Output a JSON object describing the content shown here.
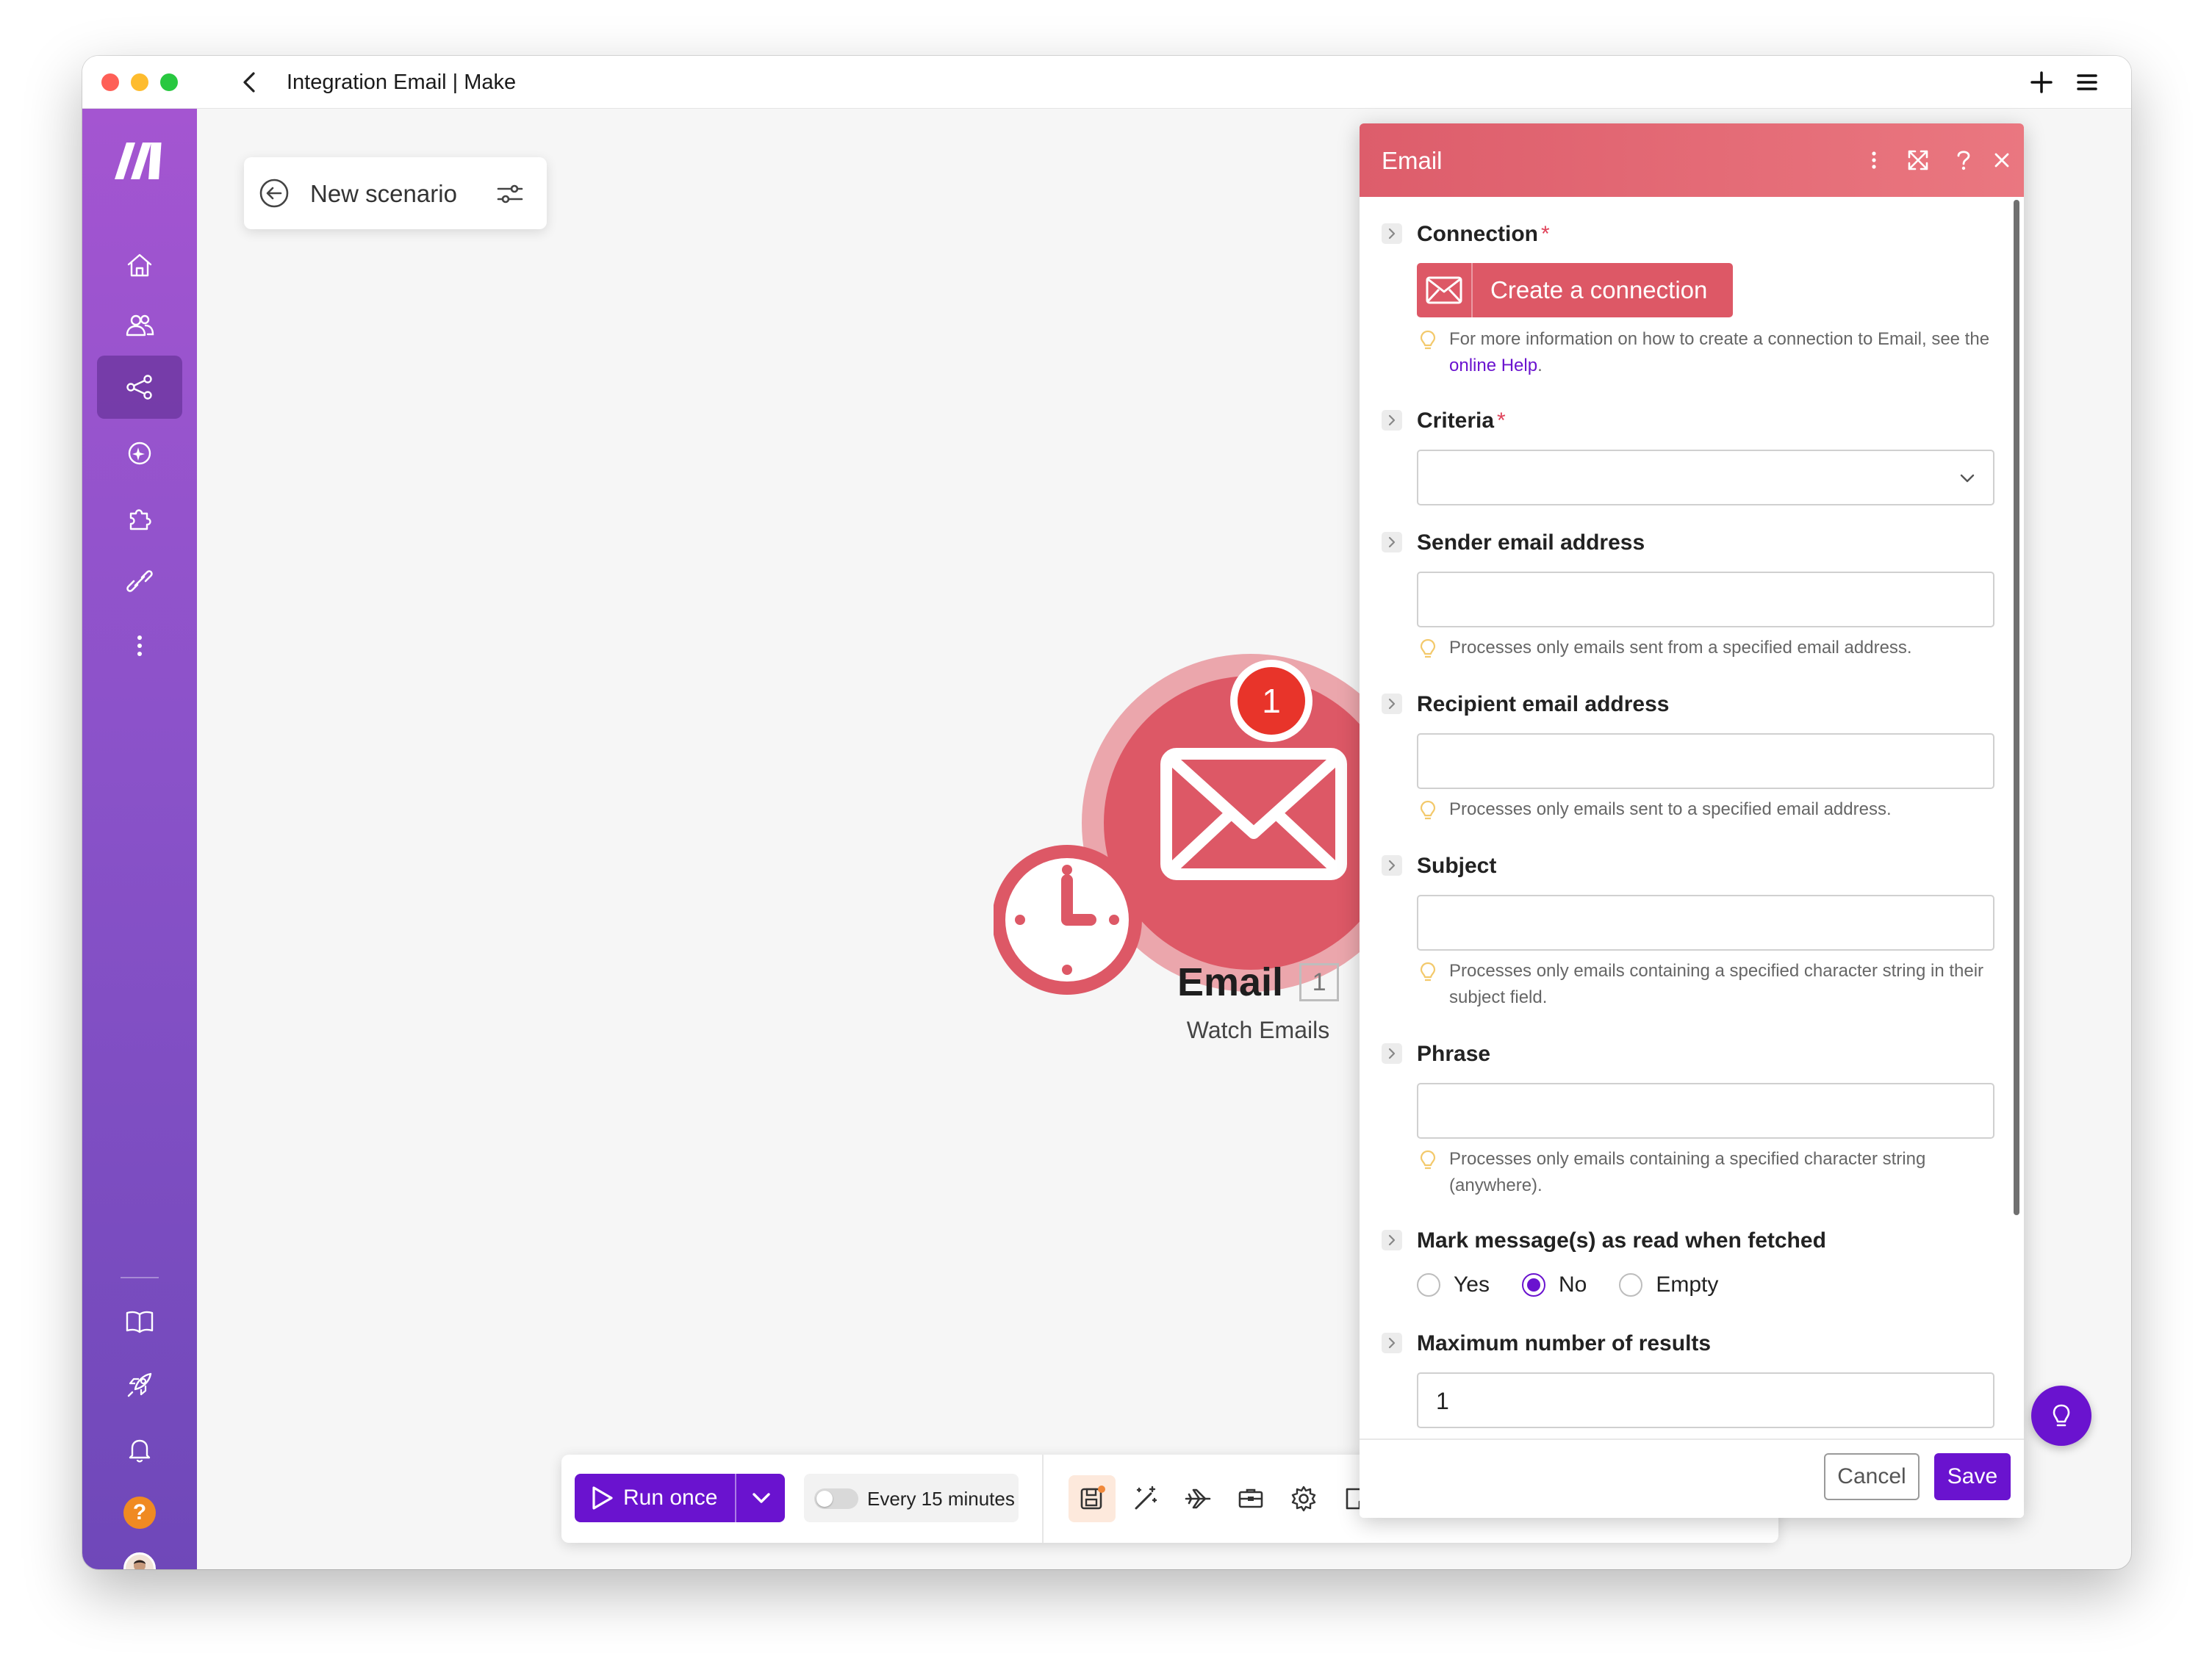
{
  "window": {
    "title": "Integration Email | Make"
  },
  "scenario": {
    "title": "New scenario"
  },
  "module": {
    "name": "Email",
    "number": "1",
    "badge": "1",
    "action": "Watch Emails",
    "color": "#dd5866"
  },
  "toolbar": {
    "run_label": "Run once",
    "schedule_label": "Every 15 minutes"
  },
  "panel": {
    "title": "Email",
    "connection": {
      "label": "Connection",
      "required": "*",
      "button_label": "Create a connection",
      "help_text": "For more information on how to create a connection to Email, see the ",
      "help_link": "online Help",
      "help_suffix": "."
    },
    "criteria": {
      "label": "Criteria",
      "required": "*",
      "value": ""
    },
    "sender": {
      "label": "Sender email address",
      "value": "",
      "help": "Processes only emails sent from a specified email address."
    },
    "recipient": {
      "label": "Recipient email address",
      "value": "",
      "help": "Processes only emails sent to a specified email address."
    },
    "subject": {
      "label": "Subject",
      "value": "",
      "help": "Processes only emails containing a specified character string in their subject field."
    },
    "phrase": {
      "label": "Phrase",
      "value": "",
      "help": "Processes only emails containing a specified character string (anywhere)."
    },
    "mark_read": {
      "label": "Mark message(s) as read when fetched",
      "options": [
        "Yes",
        "No",
        "Empty"
      ],
      "selected": "No"
    },
    "max_results": {
      "label": "Maximum number of results",
      "value": "1"
    },
    "cancel_label": "Cancel",
    "save_label": "Save"
  },
  "colors": {
    "brand_purple": "#6a13cf",
    "panel_header": "#dd5d6b",
    "badge_red": "#e8342a"
  }
}
